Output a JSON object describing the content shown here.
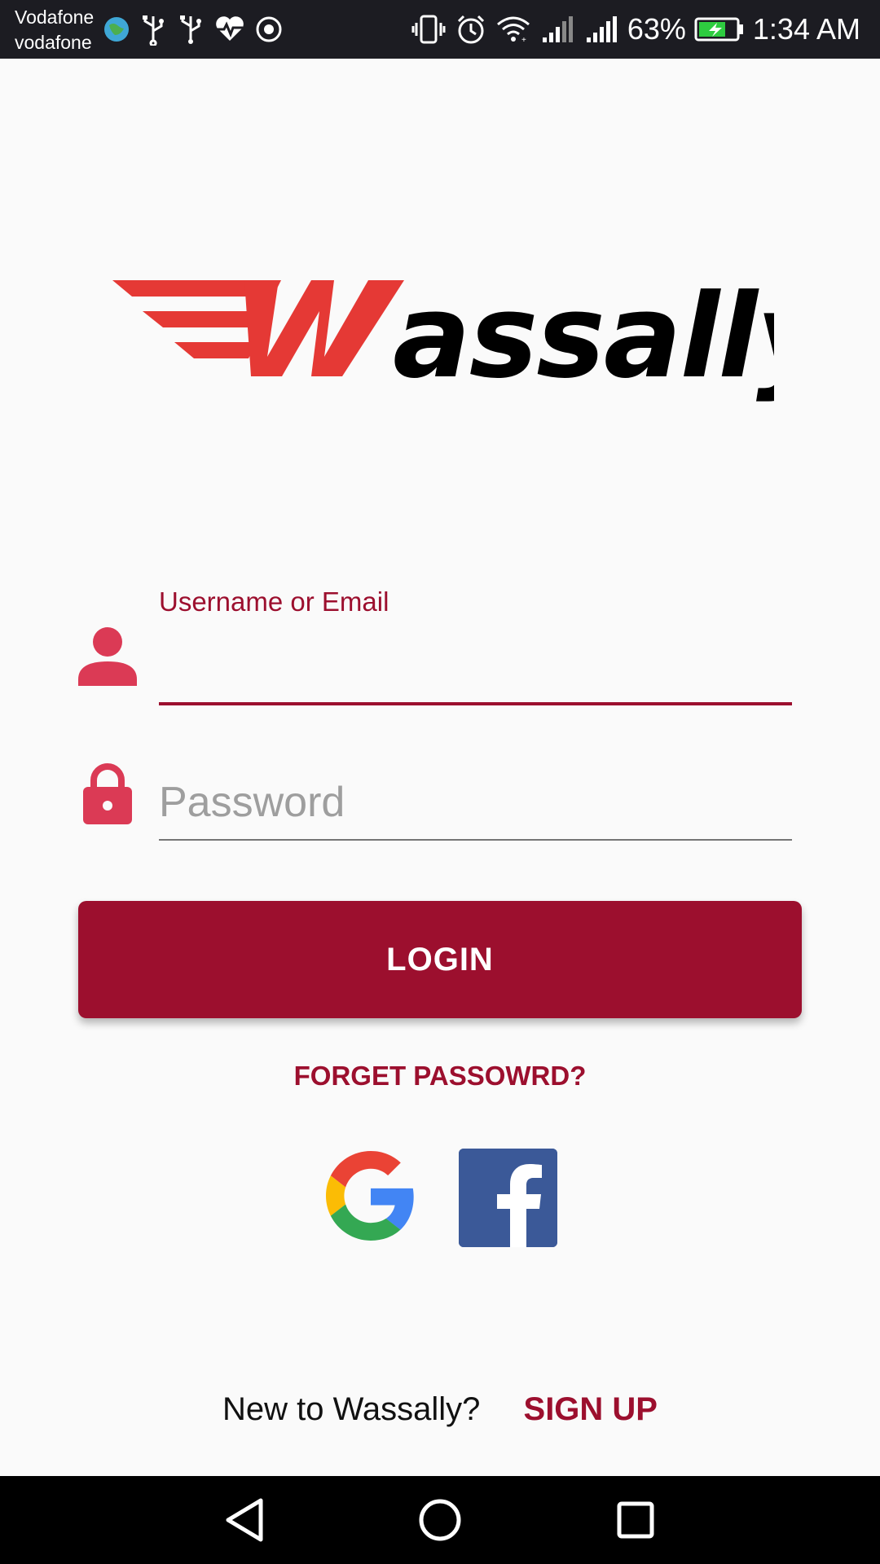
{
  "status_bar": {
    "carrier_line1": "Vodafone",
    "carrier_line2": "vodafone",
    "battery_percent": "63%",
    "time": "1:34 AM",
    "left_icons": [
      "globe-icon",
      "usb-icon",
      "usb-icon",
      "heart-monitor-icon",
      "target-icon"
    ],
    "right_icons": [
      "vibrate-icon",
      "alarm-icon",
      "wifi-icon",
      "signal-icon",
      "signal-icon",
      "battery-charging-icon"
    ]
  },
  "logo": {
    "text": "Wassally",
    "colors": {
      "accent": "#e53935",
      "text": "#000000"
    }
  },
  "form": {
    "username_label": "Username or Email",
    "username_value": "",
    "password_placeholder": "Password",
    "password_value": "",
    "icons": {
      "username": "person-icon",
      "password": "lock-icon"
    }
  },
  "actions": {
    "login_label": "LOGIN",
    "forget_password_label": "FORGET PASSOWRD?"
  },
  "social": {
    "google_icon": "google-icon",
    "facebook_icon": "facebook-icon"
  },
  "footer": {
    "signup_prompt": "New to Wassally?",
    "signup_label": "SIGN UP"
  },
  "nav": {
    "back_icon": "back-triangle-icon",
    "home_icon": "home-circle-icon",
    "recents_icon": "recents-square-icon"
  },
  "colors": {
    "primary": "#9c0f2e",
    "icon_red": "#db3a55",
    "background": "#fafafa",
    "facebook_blue": "#3b5998"
  }
}
